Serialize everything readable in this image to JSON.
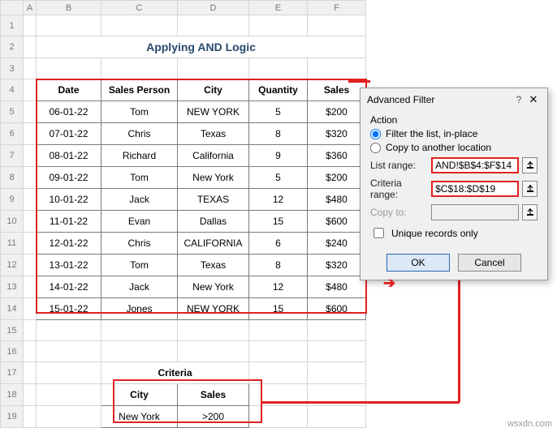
{
  "columns": [
    "A",
    "B",
    "C",
    "D",
    "E",
    "F"
  ],
  "rows": [
    1,
    2,
    3,
    4,
    5,
    6,
    7,
    8,
    9,
    10,
    11,
    12,
    13,
    14,
    15,
    16,
    17,
    18,
    19
  ],
  "title": "Applying AND Logic",
  "headers": {
    "date": "Date",
    "person": "Sales Person",
    "city": "City",
    "qty": "Quantity",
    "sales": "Sales"
  },
  "data": [
    {
      "date": "06-01-22",
      "person": "Tom",
      "city": "NEW YORK",
      "qty": "5",
      "sales": "$200"
    },
    {
      "date": "07-01-22",
      "person": "Chris",
      "city": "Texas",
      "qty": "8",
      "sales": "$320"
    },
    {
      "date": "08-01-22",
      "person": "Richard",
      "city": "California",
      "qty": "9",
      "sales": "$360"
    },
    {
      "date": "09-01-22",
      "person": "Tom",
      "city": "New York",
      "qty": "5",
      "sales": "$200"
    },
    {
      "date": "10-01-22",
      "person": "Jack",
      "city": "TEXAS",
      "qty": "12",
      "sales": "$480"
    },
    {
      "date": "11-01-22",
      "person": "Evan",
      "city": "Dallas",
      "qty": "15",
      "sales": "$600"
    },
    {
      "date": "12-01-22",
      "person": "Chris",
      "city": "CALIFORNIA",
      "qty": "6",
      "sales": "$240"
    },
    {
      "date": "13-01-22",
      "person": "Tom",
      "city": "Texas",
      "qty": "8",
      "sales": "$320"
    },
    {
      "date": "14-01-22",
      "person": "Jack",
      "city": "New York",
      "qty": "12",
      "sales": "$480"
    },
    {
      "date": "15-01-22",
      "person": "Jones",
      "city": "NEW YORK",
      "qty": "15",
      "sales": "$600"
    }
  ],
  "criteria": {
    "title": "Criteria",
    "h_city": "City",
    "h_sales": "Sales",
    "city": "New York",
    "sales": ">200"
  },
  "dialog": {
    "title": "Advanced Filter",
    "help": "?",
    "close": "✕",
    "action": "Action",
    "opt1": "Filter the list, in-place",
    "opt2": "Copy to another location",
    "list_label": "List range:",
    "list_val": "AND!$B$4:$F$14",
    "crit_label": "Criteria range:",
    "crit_val": "$C$18:$D$19",
    "copy_label": "Copy to:",
    "copy_val": "",
    "unique": "Unique records only",
    "ok": "OK",
    "cancel": "Cancel"
  },
  "watermark": "wsxdn.com"
}
